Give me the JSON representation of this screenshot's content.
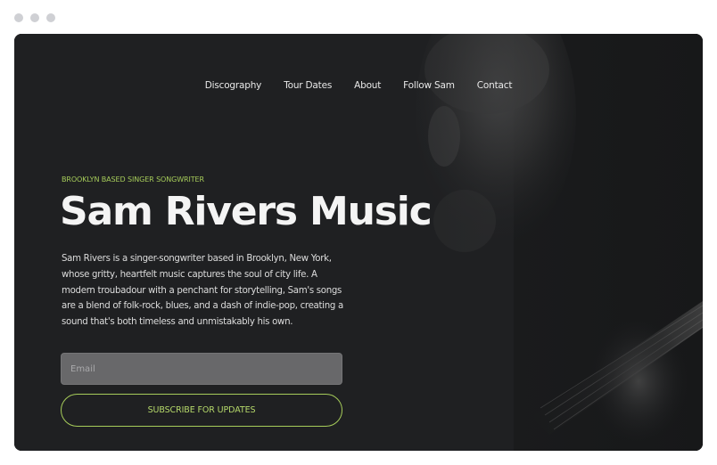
{
  "window": {
    "controls": [
      "dot",
      "dot",
      "dot"
    ]
  },
  "nav": {
    "items": [
      {
        "label": "Discography"
      },
      {
        "label": "Tour Dates"
      },
      {
        "label": "About"
      },
      {
        "label": "Follow Sam"
      },
      {
        "label": "Contact"
      }
    ]
  },
  "hero": {
    "eyebrow": "BROOKLYN BASED SINGER SONGWRITER",
    "title": "Sam Rivers Music",
    "bio": "Sam Rivers is a singer-songwriter based in Brooklyn, New York, whose gritty, heartfelt music captures the soul of city life. A modern troubadour with a penchant for storytelling, Sam's songs are a blend of folk-rock, blues, and a dash of indie-pop, creating a sound that's both timeless and unmistakably his own.",
    "background_image": "guitarist-portrait-photo"
  },
  "signup": {
    "email_placeholder": "Email",
    "email_value": "",
    "button_label": "SUBSCRIBE FOR UPDATES"
  },
  "colors": {
    "accent": "#a6cc5a",
    "background": "#1f2022",
    "input_bg": "#68686a"
  }
}
